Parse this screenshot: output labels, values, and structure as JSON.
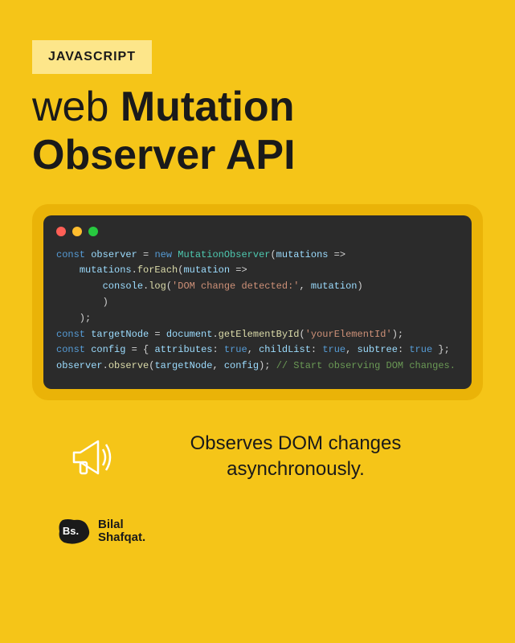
{
  "badge": "JAVASCRIPT",
  "title": {
    "prefix": "web ",
    "bold": "Mutation Observer API"
  },
  "code": {
    "lines": [
      [
        {
          "c": "kw",
          "t": "const"
        },
        {
          "c": "pn",
          "t": " "
        },
        {
          "c": "var",
          "t": "observer"
        },
        {
          "c": "pn",
          "t": " = "
        },
        {
          "c": "kw",
          "t": "new"
        },
        {
          "c": "pn",
          "t": " "
        },
        {
          "c": "cls",
          "t": "MutationObserver"
        },
        {
          "c": "pn",
          "t": "("
        },
        {
          "c": "var",
          "t": "mutations"
        },
        {
          "c": "pn",
          "t": " =>"
        }
      ],
      [
        {
          "c": "pn",
          "t": "    "
        },
        {
          "c": "var",
          "t": "mutations"
        },
        {
          "c": "pn",
          "t": "."
        },
        {
          "c": "fn",
          "t": "forEach"
        },
        {
          "c": "pn",
          "t": "("
        },
        {
          "c": "var",
          "t": "mutation"
        },
        {
          "c": "pn",
          "t": " =>"
        }
      ],
      [
        {
          "c": "pn",
          "t": "        "
        },
        {
          "c": "var",
          "t": "console"
        },
        {
          "c": "pn",
          "t": "."
        },
        {
          "c": "fn",
          "t": "log"
        },
        {
          "c": "pn",
          "t": "("
        },
        {
          "c": "str",
          "t": "'DOM change detected:'"
        },
        {
          "c": "pn",
          "t": ", "
        },
        {
          "c": "var",
          "t": "mutation"
        },
        {
          "c": "pn",
          "t": ")"
        }
      ],
      [
        {
          "c": "pn",
          "t": "        )"
        }
      ],
      [
        {
          "c": "pn",
          "t": "    );"
        }
      ],
      [
        {
          "c": "kw",
          "t": "const"
        },
        {
          "c": "pn",
          "t": " "
        },
        {
          "c": "var",
          "t": "targetNode"
        },
        {
          "c": "pn",
          "t": " = "
        },
        {
          "c": "var",
          "t": "document"
        },
        {
          "c": "pn",
          "t": "."
        },
        {
          "c": "fn",
          "t": "getElementById"
        },
        {
          "c": "pn",
          "t": "("
        },
        {
          "c": "str",
          "t": "'yourElementId'"
        },
        {
          "c": "pn",
          "t": ");"
        }
      ],
      [
        {
          "c": "kw",
          "t": "const"
        },
        {
          "c": "pn",
          "t": " "
        },
        {
          "c": "var",
          "t": "config"
        },
        {
          "c": "pn",
          "t": " = { "
        },
        {
          "c": "prop",
          "t": "attributes"
        },
        {
          "c": "pn",
          "t": ": "
        },
        {
          "c": "bool",
          "t": "true"
        },
        {
          "c": "pn",
          "t": ", "
        },
        {
          "c": "prop",
          "t": "childList"
        },
        {
          "c": "pn",
          "t": ": "
        },
        {
          "c": "bool",
          "t": "true"
        },
        {
          "c": "pn",
          "t": ", "
        },
        {
          "c": "prop",
          "t": "subtree"
        },
        {
          "c": "pn",
          "t": ": "
        },
        {
          "c": "bool",
          "t": "true"
        },
        {
          "c": "pn",
          "t": " };"
        }
      ],
      [
        {
          "c": "var",
          "t": "observer"
        },
        {
          "c": "pn",
          "t": "."
        },
        {
          "c": "fn",
          "t": "observe"
        },
        {
          "c": "pn",
          "t": "("
        },
        {
          "c": "var",
          "t": "targetNode"
        },
        {
          "c": "pn",
          "t": ", "
        },
        {
          "c": "var",
          "t": "config"
        },
        {
          "c": "pn",
          "t": "); "
        },
        {
          "c": "cmt",
          "t": "// Start observing DOM changes."
        }
      ]
    ]
  },
  "caption": "Observes DOM changes asynchronously.",
  "author": {
    "badge_text": "Bs.",
    "name_line1": "Bilal",
    "name_line2": "Shafqat."
  }
}
